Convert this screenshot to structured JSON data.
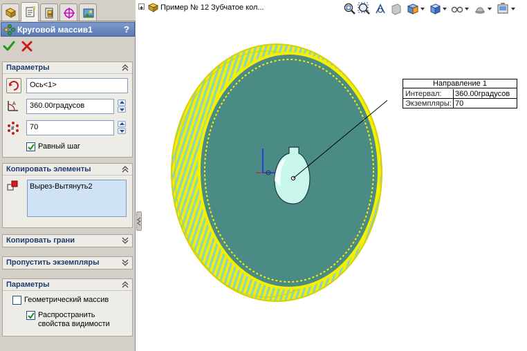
{
  "property_manager": {
    "feature_title": "Круговой массив1",
    "help_label": "?",
    "groups": {
      "params": {
        "title": "Параметры",
        "axis_value": "Ось<1>",
        "angle_value": "360.00градусов",
        "count_value": "70",
        "equal_spacing_label": "Равный шаг",
        "equal_spacing_checked": true
      },
      "copy_features": {
        "title": "Копировать элементы",
        "items": [
          "Вырез-Вытянуть2"
        ]
      },
      "copy_faces": {
        "title": "Копировать грани"
      },
      "skip_instances": {
        "title": "Пропустить экземпляры"
      },
      "options": {
        "title": "Параметры",
        "geometric_pattern_label": "Геометрический массив",
        "geometric_pattern_checked": false,
        "propagate_label_line1": "Распространить",
        "propagate_label_line2": "свойства видимости",
        "propagate_checked": true
      }
    }
  },
  "graphics": {
    "tree_label": "Пример № 12 Зубчатое кол...",
    "callout": {
      "title": "Направление 1",
      "rows": [
        {
          "label": "Интервал:",
          "value": "360.00градусов"
        },
        {
          "label": "Экземпляры:",
          "value": "70"
        }
      ]
    },
    "heads_up_icons": [
      "zoom-to-fit-icon",
      "zoom-area-icon",
      "rotate-view-icon",
      "section-view-icon",
      "view-orientation-icon",
      "display-style-icon",
      "hide-show-icon",
      "edit-appearance-icon",
      "apply-scene-icon"
    ]
  },
  "colors": {
    "gear_face": "#4b8b86",
    "gear_teeth": "#f5f000",
    "gear_rim": "#c9f7ee",
    "title_bar": "#5a7ab6"
  }
}
